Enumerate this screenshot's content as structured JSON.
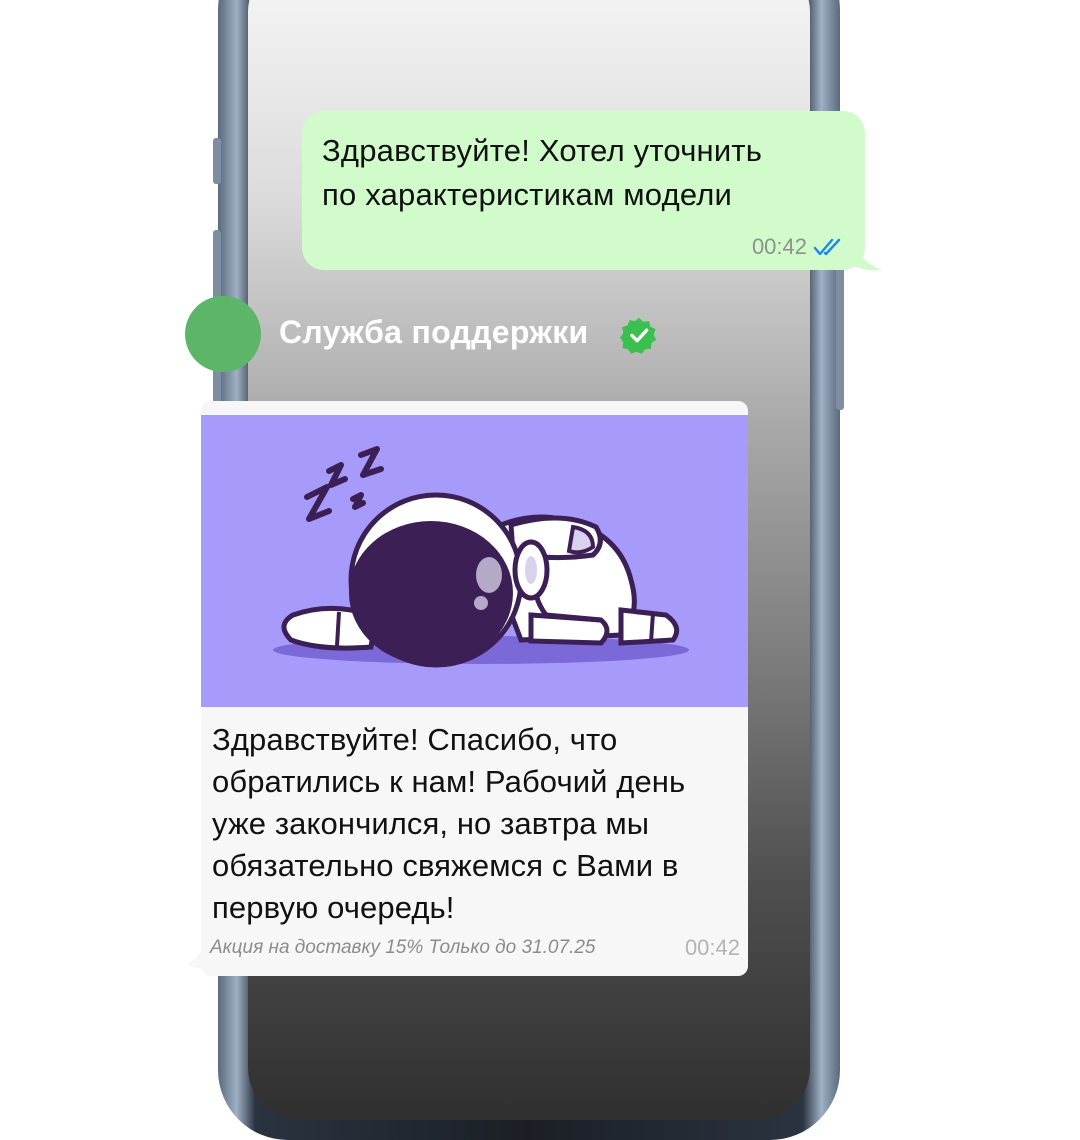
{
  "outgoing_message": {
    "text_line1": "Здравствуйте! Хотел уточнить",
    "text_line2": "по характеристикам модели",
    "time": "00:42",
    "status_icon": "double-check-read-icon",
    "bubble_color": "#d2fbcc",
    "status_color": "#1e88e5"
  },
  "sender": {
    "name": "Служба поддержки",
    "avatar_color": "#5db567",
    "verified_icon": "verified-badge-icon",
    "verified_color": "#3bbf4f"
  },
  "incoming_message": {
    "sticker_name": "sleeping-astronaut-sticker",
    "sticker_background": "#a69bfa",
    "text_lines": [
      "Здравствуйте! Спасибо, что",
      "обратились к нам! Рабочий день",
      "уже закончился, но завтра мы",
      "обязательно свяжемся с Вами в",
      "первую очередь!"
    ],
    "promo": "Акция на доставку 15% Только до 31.07.25",
    "time": "00:42"
  }
}
